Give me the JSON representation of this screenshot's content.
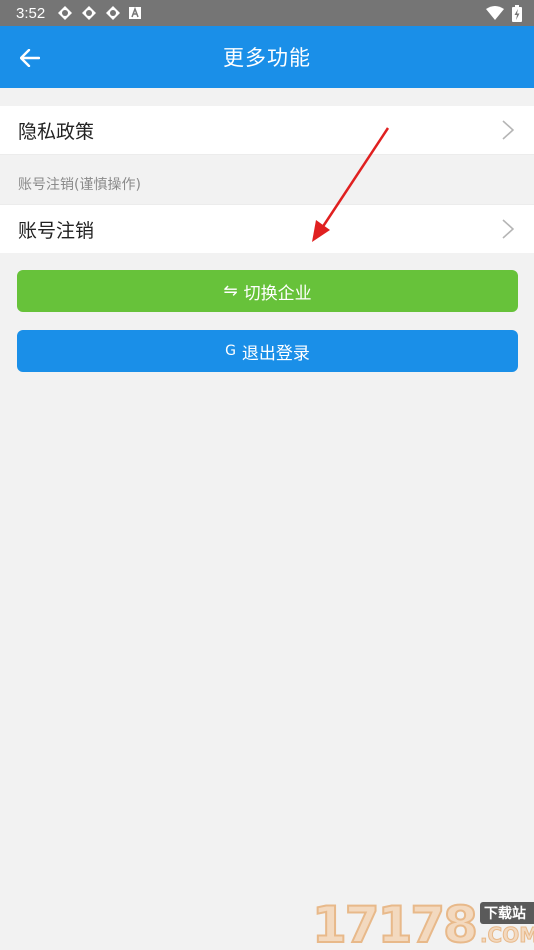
{
  "status_bar": {
    "time": "3:52",
    "notification_icons": [
      "sync-icon",
      "sync-icon",
      "sync-icon",
      "a-box-icon"
    ],
    "right_icons": [
      "wifi-icon",
      "battery-charging-icon"
    ]
  },
  "app_bar": {
    "title": "更多功能",
    "back_icon": "arrow-left-icon"
  },
  "menu": {
    "privacy_label": "隐私政策",
    "section_label": "账号注销(谨慎操作)",
    "deactivate_label": "账号注销"
  },
  "buttons": {
    "switch_company_label": "切换企业",
    "switch_company_icon": "⇋",
    "logout_label": "退出登录",
    "logout_icon": "G"
  },
  "watermark": {
    "numbers": "17178",
    "cn_text": "下载站",
    "com_text": ".COM"
  },
  "colors": {
    "primary_blue": "#1a8fe8",
    "green": "#67c23a",
    "status_bar": "#757575",
    "background": "#f2f2f2",
    "annotation_arrow": "#e02020"
  }
}
